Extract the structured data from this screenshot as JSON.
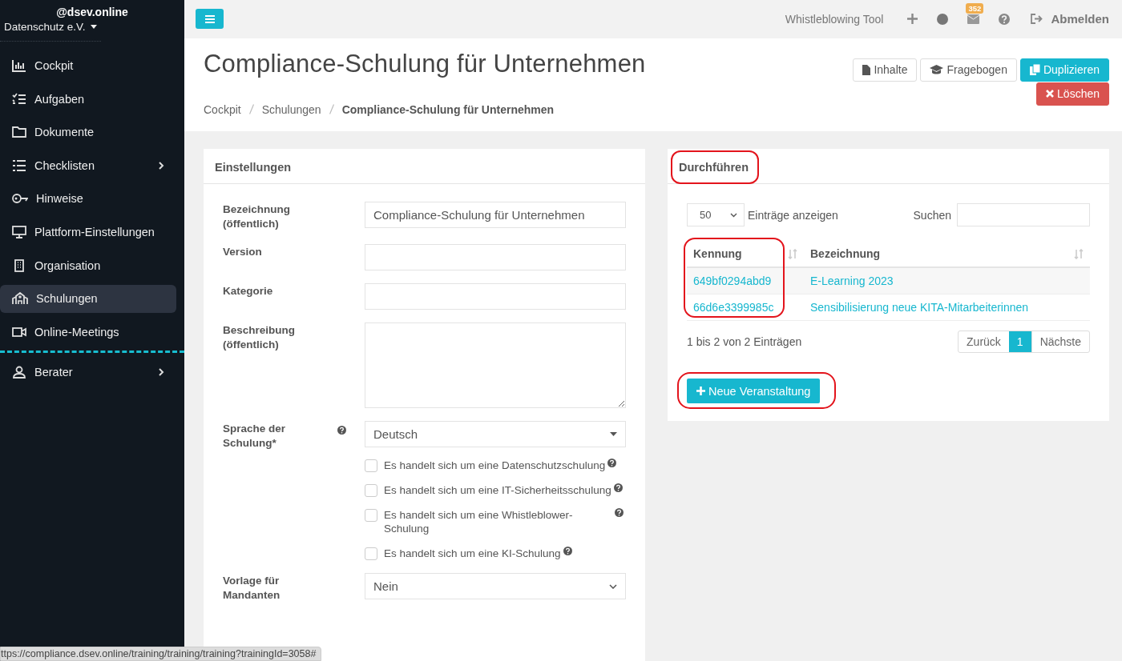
{
  "sidebar": {
    "account": "@dsev.online",
    "organization": "Datenschutz e.V.",
    "items": [
      {
        "label": "Cockpit",
        "selected": false,
        "expandable": false
      },
      {
        "label": "Aufgaben",
        "selected": false,
        "expandable": false
      },
      {
        "label": "Dokumente",
        "selected": false,
        "expandable": false
      },
      {
        "label": "Checklisten",
        "selected": false,
        "expandable": true
      },
      {
        "label": "Hinweise",
        "selected": false,
        "expandable": false
      },
      {
        "label": "Plattform-Einstellungen",
        "selected": false,
        "expandable": false
      },
      {
        "label": "Organisation",
        "selected": false,
        "expandable": false
      },
      {
        "label": "Schulungen",
        "selected": true,
        "expandable": false
      },
      {
        "label": "Online-Meetings",
        "selected": false,
        "expandable": false
      }
    ],
    "footer_items": [
      {
        "label": "Berater",
        "selected": false,
        "expandable": true
      }
    ]
  },
  "topbar": {
    "link": "Whistleblowing Tool",
    "mail_badge": "352",
    "logout": "Abmelden"
  },
  "page_header": {
    "title": "Compliance-Schulung für Unternehmen",
    "breadcrumbs": [
      {
        "label": "Cockpit",
        "current": false
      },
      {
        "label": "Schulungen",
        "current": false
      },
      {
        "label": "Compliance-Schulung für Unternehmen",
        "current": true
      }
    ],
    "actions": [
      {
        "label": "Inhalte",
        "kind": "default"
      },
      {
        "label": "Fragebogen",
        "kind": "default"
      },
      {
        "label": "Duplizieren",
        "kind": "primary"
      },
      {
        "label": "Löschen",
        "kind": "danger"
      }
    ]
  },
  "settings": {
    "title": "Einstellungen",
    "fields": [
      {
        "kind": "text",
        "label": "Bezeichnung (öffentlich)",
        "value": "Compliance-Schulung für Unternehmen",
        "help": false
      },
      {
        "kind": "text",
        "label": "Version",
        "help": false
      },
      {
        "kind": "text",
        "label": "Kategorie",
        "help": false
      },
      {
        "kind": "textarea",
        "label": "Beschreibung (öffentlich)",
        "help": false
      },
      {
        "kind": "select",
        "label": "Sprache der Schulung*",
        "value": "Deutsch",
        "help": true
      },
      {
        "kind": "checkboxes",
        "options": [
          {
            "label": "Es handelt sich um eine Datenschutzschulung",
            "checked": false
          },
          {
            "label": "Es handelt sich um eine IT-Sicherheitsschulung",
            "checked": false
          },
          {
            "label": "Es handelt sich um eine Whistleblower-Schulung",
            "checked": false
          },
          {
            "label": "Es handelt sich um eine KI-Schulung",
            "checked": false
          }
        ]
      },
      {
        "kind": "select2",
        "label": "Vorlage für Mandanten",
        "value": "Nein",
        "help": false
      }
    ]
  },
  "events": {
    "title": "Durchführen",
    "title_highlighted": true,
    "page_size": "50",
    "page_size_label": "Einträge anzeigen",
    "search_label": "Suchen",
    "columns": [
      {
        "label": "Kennung",
        "highlighted": true
      },
      {
        "label": "Bezeichnung",
        "highlighted": false
      }
    ],
    "rows": [
      [
        "649bf0294abd9",
        "E-Learning 2023"
      ],
      [
        "66d6e3399985c",
        "Sensibilisierung neue KITA-Mitarbeiterinnen"
      ]
    ],
    "info": "1 bis 2 von 2 Einträgen",
    "pagination": {
      "previous": "Zurück",
      "pages": [
        {
          "label": "1",
          "selected": true
        }
      ],
      "next": "Nächste"
    },
    "add_button": "Neue Veranstaltung",
    "add_highlighted": true
  },
  "status_url": "ttps://compliance.dsev.online/training/training/training?trainingId=3058#"
}
